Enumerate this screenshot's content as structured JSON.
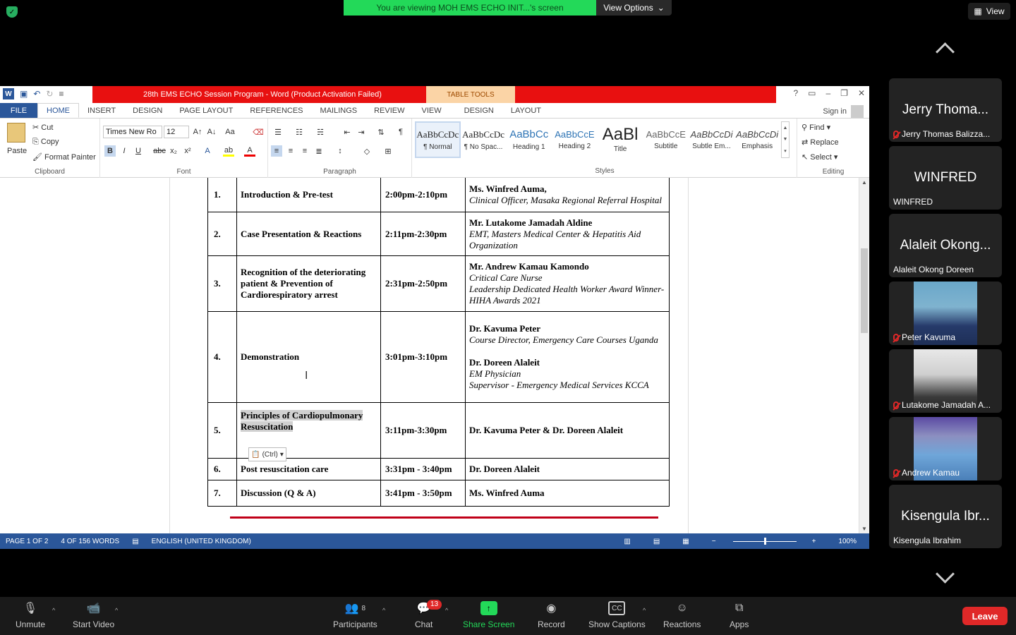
{
  "zoom": {
    "viewing_banner": "You are viewing MOH EMS ECHO INIT...'s screen",
    "view_options": "View Options",
    "view_button": "View",
    "participants": [
      {
        "big": "Jerry Thoma...",
        "label": "Jerry Thomas Balizza...",
        "muted": true
      },
      {
        "big": "WINFRED",
        "label": "WINFRED",
        "muted": false
      },
      {
        "big": "Alaleit Okong...",
        "label": "Alaleit Okong Doreen",
        "muted": false
      },
      {
        "big": "",
        "label": "Peter Kavuma",
        "muted": true
      },
      {
        "big": "",
        "label": "Lutakome Jamadah A...",
        "muted": true
      },
      {
        "big": "",
        "label": "Andrew Kamau",
        "muted": true
      },
      {
        "big": "Kisengula Ibr...",
        "label": "Kisengula Ibrahim",
        "muted": false
      }
    ],
    "toolbar": {
      "unmute": "Unmute",
      "start_video": "Start Video",
      "participants": "Participants",
      "participants_count": "8",
      "chat": "Chat",
      "chat_badge": "13",
      "share_screen": "Share Screen",
      "record": "Record",
      "show_captions": "Show Captions",
      "reactions": "Reactions",
      "apps": "Apps",
      "leave": "Leave"
    }
  },
  "word": {
    "title": "28th EMS ECHO Session Program  -  Word (Product Activation Failed)",
    "table_tools": "TABLE TOOLS",
    "tabs": [
      "FILE",
      "HOME",
      "INSERT",
      "DESIGN",
      "PAGE LAYOUT",
      "REFERENCES",
      "MAILINGS",
      "REVIEW",
      "VIEW",
      "DESIGN",
      "LAYOUT"
    ],
    "sign_in": "Sign in",
    "ribbon": {
      "paste": "Paste",
      "cut": "Cut",
      "copy": "Copy",
      "format_painter": "Format Painter",
      "clipboard": "Clipboard",
      "font_name": "Times New Ro",
      "font_size": "12",
      "font": "Font",
      "paragraph": "Paragraph",
      "styles_label": "Styles",
      "editing": "Editing",
      "find": "Find",
      "replace": "Replace",
      "select": "Select",
      "styles": [
        {
          "preview": "AaBbCcDc",
          "name": "¶ Normal"
        },
        {
          "preview": "AaBbCcDc",
          "name": "¶ No Spac..."
        },
        {
          "preview": "AaBbCc",
          "name": "Heading 1"
        },
        {
          "preview": "AaBbCcE",
          "name": "Heading 2"
        },
        {
          "preview": "AaBl",
          "name": "Title"
        },
        {
          "preview": "AaBbCcE",
          "name": "Subtitle"
        },
        {
          "preview": "AaBbCcDi",
          "name": "Subtle Em..."
        },
        {
          "preview": "AaBbCcDi",
          "name": "Emphasis"
        }
      ]
    },
    "rows": [
      {
        "num": "1.",
        "topic": "Introduction & Pre-test",
        "time": "2:00pm-2:10pm",
        "speakers": [
          {
            "name": "Ms. Winfred Auma,",
            "lines": [
              "Clinical Officer, Masaka Regional Referral Hospital"
            ]
          }
        ]
      },
      {
        "num": "2.",
        "topic": "Case Presentation & Reactions",
        "time": "2:11pm-2:30pm",
        "speakers": [
          {
            "name": "Mr. Lutakome Jamadah Aldine",
            "lines": [
              "EMT, Masters Medical Center & Hepatitis Aid Organization"
            ]
          }
        ]
      },
      {
        "num": "3.",
        "topic": "Recognition of the deteriorating patient & Prevention of Cardiorespiratory arrest",
        "time": "2:31pm-2:50pm",
        "speakers": [
          {
            "name": "Mr. Andrew Kamau Kamondo",
            "lines": [
              "Critical Care Nurse",
              "Leadership Dedicated Health Worker Award Winner- HIHA Awards 2021"
            ]
          }
        ]
      },
      {
        "num": "4.",
        "topic": "Demonstration",
        "time": "3:01pm-3:10pm",
        "speakers": [
          {
            "name": "Dr. Kavuma Peter",
            "lines": [
              "Course Director, Emergency Care Courses Uganda"
            ]
          },
          {
            "name": "Dr. Doreen Alaleit",
            "lines": [
              "EM Physician",
              "Supervisor - Emergency Medical Services KCCA"
            ]
          }
        ]
      },
      {
        "num": "5.",
        "topic": "Principles of Cardiopulmonary Resuscitation",
        "time": "3:11pm-3:30pm",
        "speakers": [
          {
            "name": "Dr. Kavuma Peter & Dr. Doreen Alaleit",
            "lines": []
          }
        ]
      },
      {
        "num": "6.",
        "topic": "Post resuscitation care",
        "time": "3:31pm - 3:40pm",
        "speakers": [
          {
            "name": "Dr. Doreen Alaleit",
            "lines": []
          }
        ]
      },
      {
        "num": "7.",
        "topic": "Discussion (Q & A)",
        "time": "3:41pm - 3:50pm",
        "speakers": [
          {
            "name": "Ms. Winfred Auma",
            "lines": []
          }
        ]
      }
    ],
    "paste_ctrl": "(Ctrl)",
    "status": {
      "page": "PAGE 1 OF 2",
      "words": "4 OF 156 WORDS",
      "language": "ENGLISH (UNITED KINGDOM)",
      "zoom": "100%"
    }
  }
}
